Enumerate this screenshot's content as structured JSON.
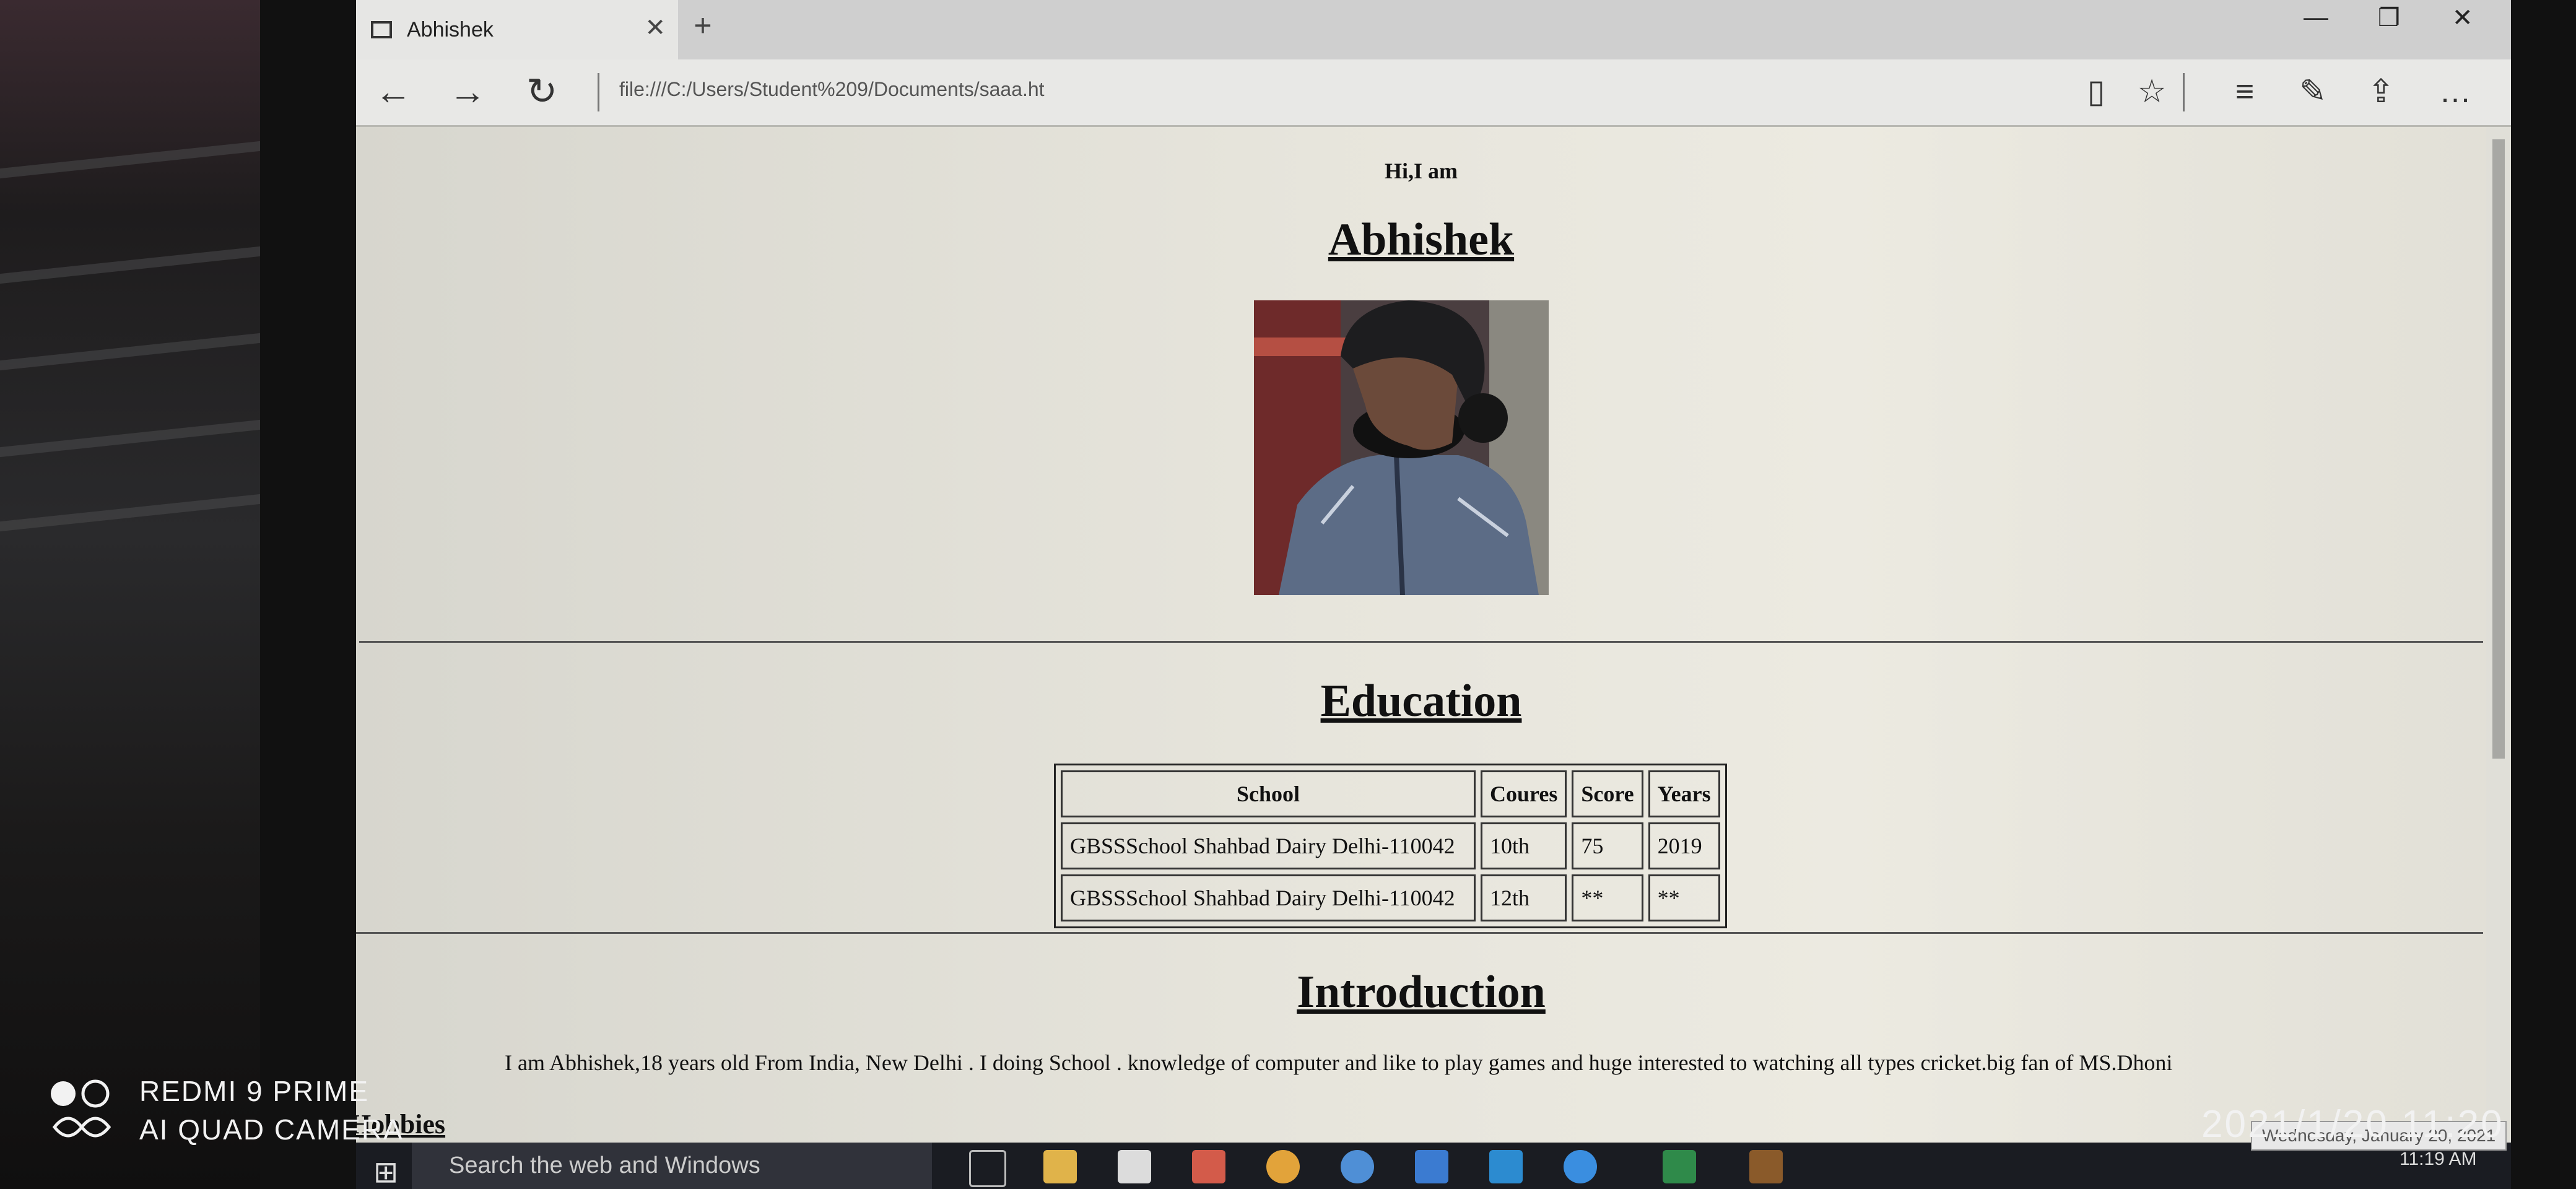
{
  "browser": {
    "tab_title": "Abhishek",
    "address": "file:///C:/Users/Student%209/Documents/saaa.ht"
  },
  "icons": {
    "back": "back-arrow-icon",
    "forward": "forward-arrow-icon",
    "refresh": "refresh-icon",
    "reading": "reading-view-icon",
    "favorite": "star-icon",
    "hub": "hub-icon",
    "note": "web-note-icon",
    "share": "share-icon",
    "more": "more-icon"
  },
  "page": {
    "greeting": "Hi,I am",
    "name": "Abhishek",
    "education_heading": "Education",
    "education_table": {
      "headers": [
        "School",
        "Coures",
        "Score",
        "Years"
      ],
      "rows": [
        [
          "GBSSSchool Shahbad Dairy Delhi-110042",
          "10th",
          "75",
          "2019"
        ],
        [
          "GBSSSchool Shahbad Dairy Delhi-110042",
          "12th",
          "**",
          "**"
        ]
      ]
    },
    "intro_heading": "Introduction",
    "intro_text": "I am Abhishek,18 years old From India, New Delhi . I doing School . knowledge of computer and like to play games and huge interested to watching all types cricket.big fan of MS.Dhoni",
    "hobbies_heading": "Hobbies"
  },
  "taskbar": {
    "search_placeholder": "Search the web and Windows",
    "time": "11:19 AM",
    "date_tooltip": "Wednesday, January 20, 2021"
  },
  "watermark": {
    "line1": "REDMI 9 PRIME",
    "line2": "AI QUAD CAMERA",
    "datetime": "2021/1/20  11:20"
  }
}
